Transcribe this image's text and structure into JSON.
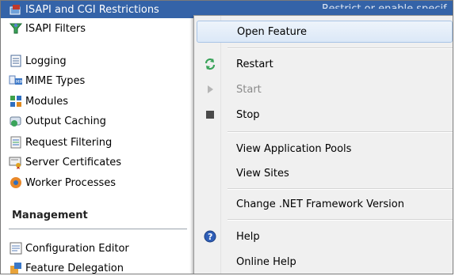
{
  "feature_list": {
    "items": [
      {
        "label": "ISAPI and CGI Restrictions",
        "icon": "isapi-cgi-icon"
      },
      {
        "label": "ISAPI Filters",
        "icon": "isapi-filters-icon"
      },
      {
        "label": "Logging",
        "icon": "logging-icon"
      },
      {
        "label": "MIME Types",
        "icon": "mime-types-icon"
      },
      {
        "label": "Modules",
        "icon": "modules-icon"
      },
      {
        "label": "Output Caching",
        "icon": "output-caching-icon"
      },
      {
        "label": "Request Filtering",
        "icon": "request-filtering-icon"
      },
      {
        "label": "Server Certificates",
        "icon": "server-certificates-icon"
      },
      {
        "label": "Worker Processes",
        "icon": "worker-processes-icon"
      }
    ],
    "management_header": "Management",
    "management_items": [
      {
        "label": "Configuration Editor",
        "icon": "configuration-editor-icon"
      },
      {
        "label": "Feature Delegation",
        "icon": "feature-delegation-icon"
      }
    ],
    "selected_description": "Restrict or enable specif"
  },
  "context_menu": {
    "items": [
      {
        "label": "Open Feature",
        "icon": "",
        "state": "highlighted"
      },
      {
        "label": "Restart",
        "icon": "restart-icon",
        "state": "enabled"
      },
      {
        "label": "Start",
        "icon": "start-icon",
        "state": "disabled"
      },
      {
        "label": "Stop",
        "icon": "stop-icon",
        "state": "enabled"
      },
      {
        "label": "View Application Pools",
        "icon": "",
        "state": "enabled"
      },
      {
        "label": "View Sites",
        "icon": "",
        "state": "enabled"
      },
      {
        "label": "Change .NET Framework Version",
        "icon": "",
        "state": "enabled"
      },
      {
        "label": "Help",
        "icon": "help-icon",
        "state": "enabled"
      },
      {
        "label": "Online Help",
        "icon": "",
        "state": "enabled"
      }
    ]
  },
  "colors": {
    "selection": "#3463a8",
    "menu_background": "#f0f0f0",
    "menu_highlight": "#dbe8f7",
    "disabled_text": "#8a8a8a"
  }
}
